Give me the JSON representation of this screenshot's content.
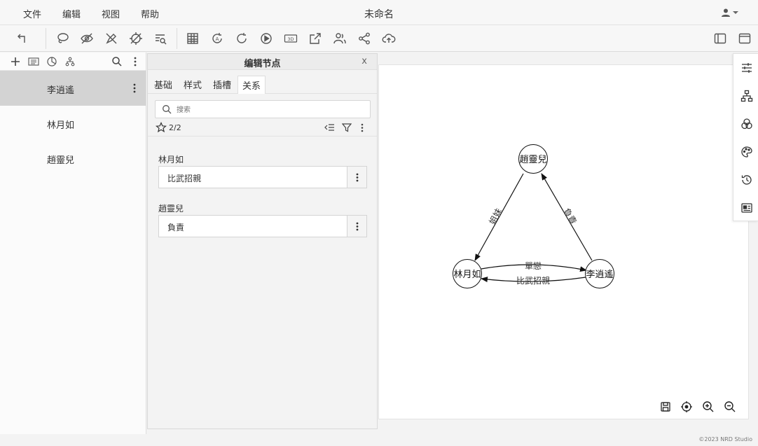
{
  "menubar": {
    "items": [
      "文件",
      "编辑",
      "视图",
      "帮助"
    ],
    "doc_title": "未命名"
  },
  "toolbar": {
    "icons": [
      "undo-icon",
      "lasso-icon",
      "hide-icon",
      "brush-icon",
      "no-select-icon",
      "filter-list-icon",
      "table-icon",
      "auto-layout-icon",
      "refresh-icon",
      "play-icon",
      "3d-icon",
      "export-icon",
      "users-icon",
      "share-icon",
      "cloud-upload-icon",
      "sidebar-left-icon",
      "window-icon"
    ],
    "three_d_label": "3D"
  },
  "left_panel": {
    "nodes": [
      {
        "label": "李逍遙",
        "selected": true
      },
      {
        "label": "林月如",
        "selected": false
      },
      {
        "label": "趙靈兒",
        "selected": false
      }
    ]
  },
  "edit_panel": {
    "title": "编辑节点",
    "close": "x",
    "tabs": [
      "基础",
      "样式",
      "插槽",
      "关系"
    ],
    "active_tab": "关系",
    "search_placeholder": "搜索",
    "count": "2/2",
    "relations": [
      {
        "target": "林月如",
        "relation": "比武招親"
      },
      {
        "target": "趙靈兒",
        "relation": "負責"
      }
    ]
  },
  "graph": {
    "nodes": [
      {
        "id": "n1",
        "label": "李逍遙"
      },
      {
        "id": "n2",
        "label": "林月如"
      },
      {
        "id": "n3",
        "label": "趙靈兒"
      }
    ],
    "edges": [
      {
        "from": "n2",
        "to": "n1",
        "label": "單戀"
      },
      {
        "from": "n1",
        "to": "n2",
        "label": "比武招親"
      },
      {
        "from": "n3",
        "to": "n2",
        "label": "姐妹"
      },
      {
        "from": "n1",
        "to": "n3",
        "label": "負責"
      }
    ]
  },
  "colors": {
    "selected_row": "#d3d3d3",
    "canvas_bg": "#ffffff",
    "panel_bg": "#f3f3f3"
  },
  "footer": {
    "copyright": "©2023 NRD Studio"
  }
}
